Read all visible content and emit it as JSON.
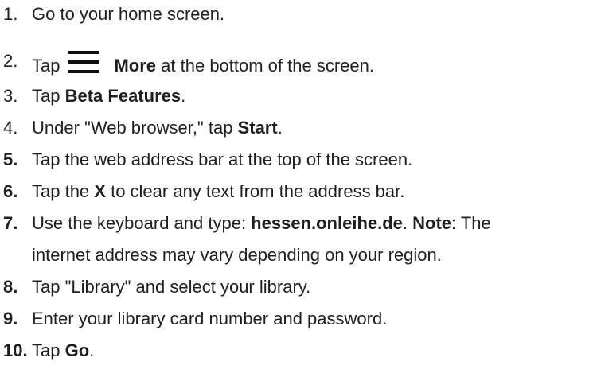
{
  "steps": [
    {
      "number": "1.",
      "parts": [
        "Go to your home screen."
      ]
    },
    {
      "number": "2.",
      "icon": "hamburger-menu-icon",
      "parts": [
        "Tap",
        "More",
        " at the bottom of the screen."
      ]
    },
    {
      "number": "3.",
      "parts": [
        "Tap ",
        "Beta Features",
        "."
      ]
    },
    {
      "number": "4.",
      "parts": [
        "Under \"Web browser,\" tap ",
        "Start",
        "."
      ]
    },
    {
      "number": "5.",
      "parts": [
        "Tap the web address bar at the top of the screen."
      ]
    },
    {
      "number": "6.",
      "parts": [
        "Tap the ",
        "X",
        " to clear any text from the address bar."
      ]
    },
    {
      "number": "7.",
      "parts": [
        "Use the keyboard and type: ",
        "hessen.onleihe.de",
        ". ",
        "Note",
        ": The",
        "internet address may vary depending on your region."
      ]
    },
    {
      "number": "8.",
      "parts": [
        "Tap \"Library\" and select your library."
      ]
    },
    {
      "number": "9.",
      "parts": [
        "Enter your library card number and password."
      ]
    },
    {
      "number": "10.",
      "parts": [
        "Tap ",
        "Go",
        "."
      ]
    }
  ]
}
